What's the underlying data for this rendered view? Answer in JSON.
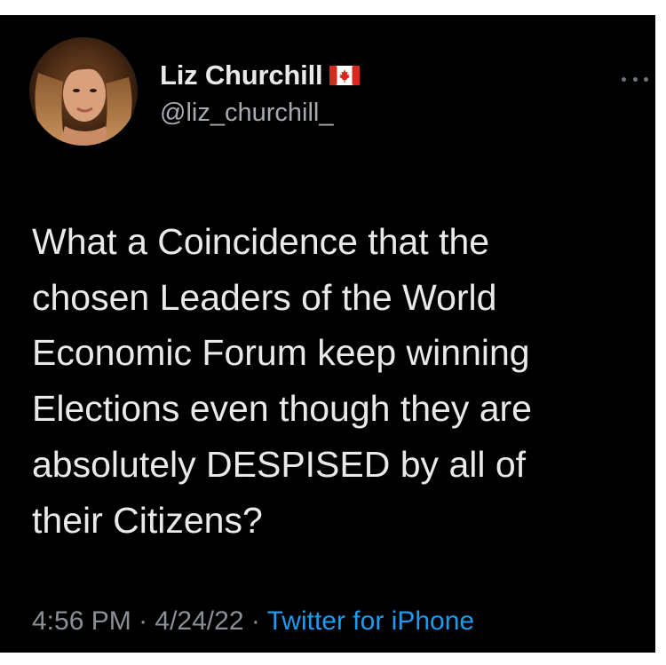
{
  "tweet": {
    "author": {
      "display_name": "Liz Churchill",
      "handle": "@liz_churchill_",
      "flag_icon": "canada-flag-icon"
    },
    "body_lines": [
      "What a Coincidence that the",
      "chosen Leaders of the World",
      "Economic Forum keep winning",
      "Elections even though they are",
      "absolutely DESPISED by all of",
      "their Citizens?"
    ],
    "meta": {
      "time": "4:56 PM",
      "separator": " · ",
      "date": "4/24/22",
      "source": "Twitter for iPhone"
    }
  },
  "colors": {
    "background": "#000000",
    "text": "#e7e9ea",
    "secondary_text": "#8b9096",
    "link": "#1d9bf0"
  }
}
